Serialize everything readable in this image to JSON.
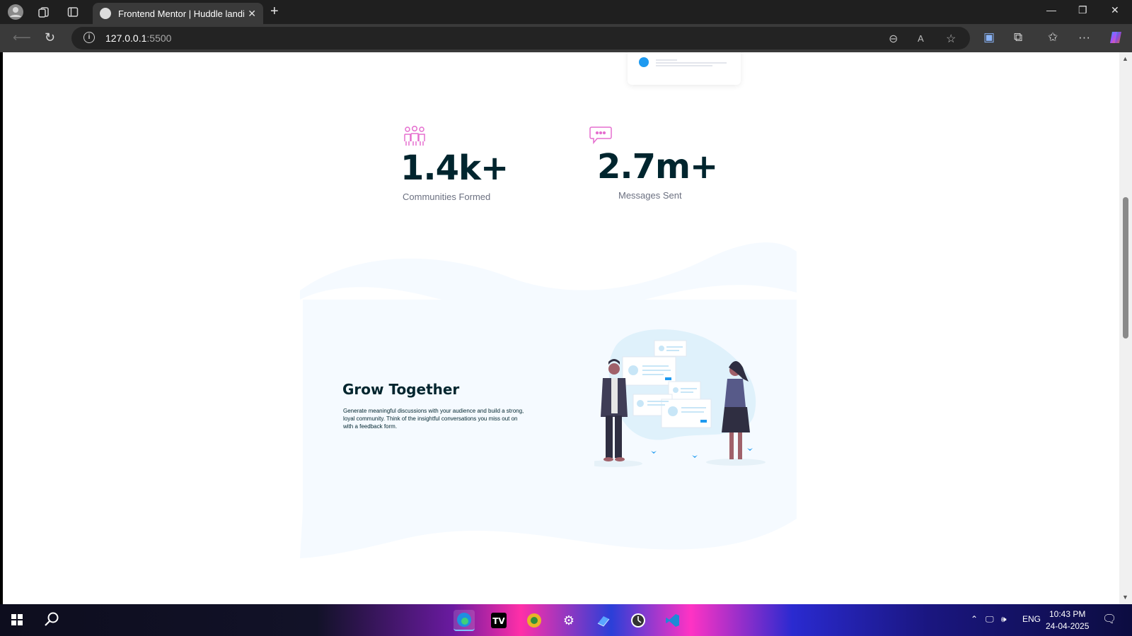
{
  "browser": {
    "tab_title": "Frontend Mentor | Huddle landing page",
    "tab_close": "✕",
    "new_tab": "+",
    "url_host": "127.0.0.1",
    "url_port": ":5500"
  },
  "stats": [
    {
      "value": "1.4k+",
      "label": "Communities Formed",
      "icon": "communities-icon"
    },
    {
      "value": "2.7m+",
      "label": "Messages Sent",
      "icon": "messages-icon"
    }
  ],
  "feature": {
    "title": "Grow Together",
    "text": "Generate meaningful discussions with your audience and build a strong, loyal community. Think of the insightful conversations you miss out on with a feedback form."
  },
  "taskbar": {
    "lang": "ENG",
    "time": "10:43 PM",
    "date": "24-04-2025"
  },
  "colors": {
    "accent": "#1e9af0",
    "icon_pink": "#e56fcf",
    "heading": "#00252e",
    "wave_fill": "#f5faff"
  }
}
